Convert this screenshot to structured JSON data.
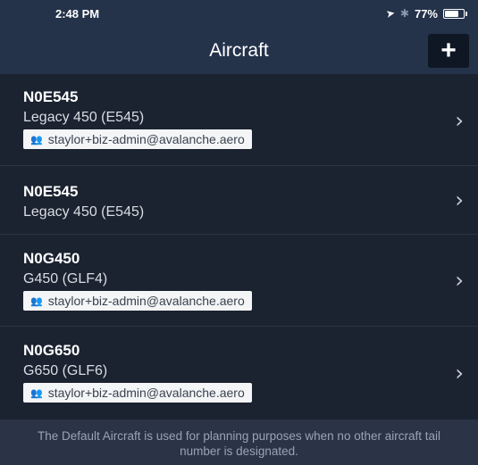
{
  "status_bar": {
    "time": "2:48 PM",
    "location_icon": "location-arrow-icon",
    "bluetooth_icon": "bluetooth-icon",
    "battery": "77%",
    "battery_level": 0.77
  },
  "nav": {
    "title": "Aircraft",
    "add_label": "+"
  },
  "aircraft": [
    {
      "tail": "N0E545",
      "model": "Legacy 450 (E545)",
      "owner": "staylor+biz-admin@avalanche.aero"
    },
    {
      "tail": "N0E545",
      "model": "Legacy 450 (E545)",
      "owner": ""
    },
    {
      "tail": "N0G450",
      "model": "G450 (GLF4)",
      "owner": "staylor+biz-admin@avalanche.aero"
    },
    {
      "tail": "N0G650",
      "model": "G650 (GLF6)",
      "owner": "staylor+biz-admin@avalanche.aero"
    }
  ],
  "footer": {
    "note": "The Default Aircraft is used for planning purposes when no other aircraft tail number is designated."
  },
  "colors": {
    "nav_background": "#24324a",
    "list_background": "#1b2230",
    "badge_background": "#f4f5f6"
  }
}
